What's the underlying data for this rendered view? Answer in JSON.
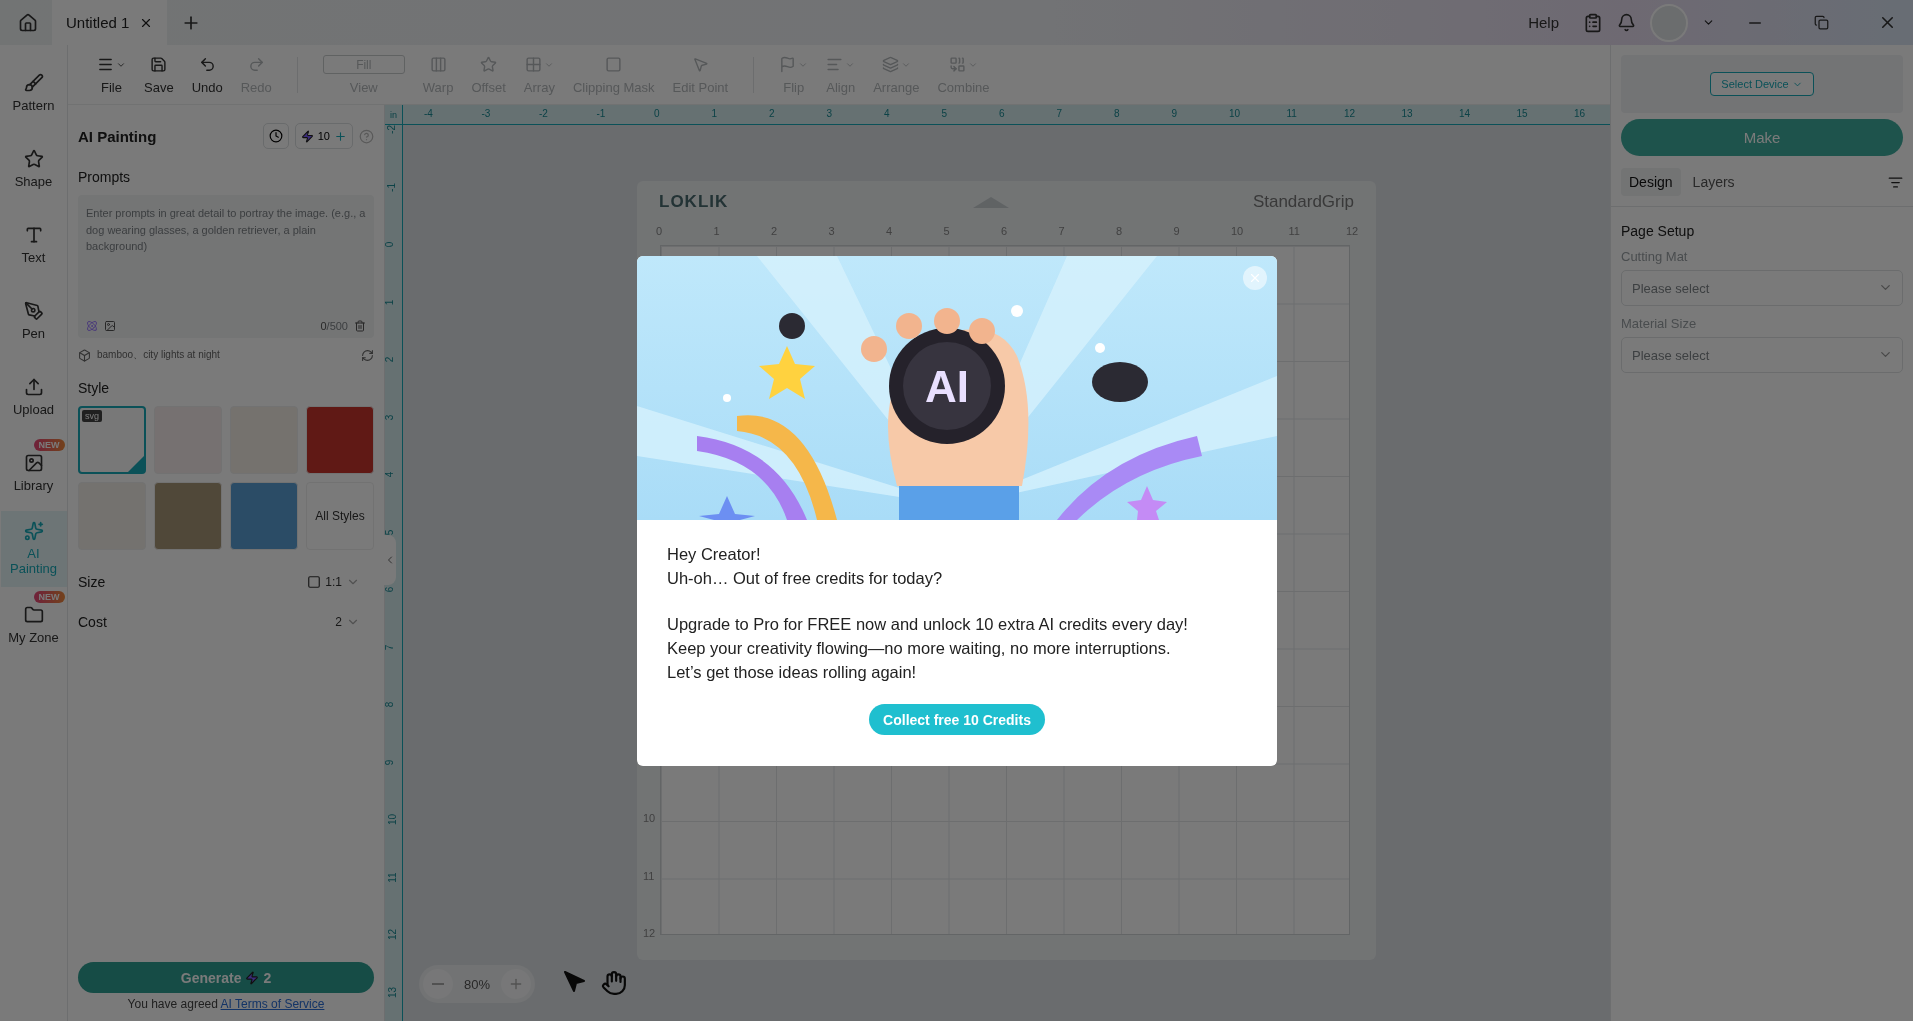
{
  "titlebar": {
    "tab": {
      "label": "Untitled 1",
      "selected": true
    },
    "help": "Help"
  },
  "rail": [
    {
      "label": "Pattern",
      "selected": false
    },
    {
      "label": "Shape",
      "selected": false
    },
    {
      "label": "Text",
      "selected": false
    },
    {
      "label": "Pen",
      "selected": false
    },
    {
      "label": "Upload",
      "selected": false
    },
    {
      "label": "Library",
      "selected": false,
      "new_badge": "NEW"
    },
    {
      "label": "AI Painting",
      "selected": true
    },
    {
      "label": "My Zone",
      "selected": false,
      "new_badge": "NEW"
    }
  ],
  "toolbar": [
    [
      {
        "label": "File",
        "disabled": false,
        "has_menu": true
      },
      {
        "label": "Save",
        "disabled": false,
        "has_menu": false
      },
      {
        "label": "Undo",
        "disabled": false,
        "has_menu": false
      },
      {
        "label": "Redo",
        "disabled": true,
        "has_menu": false
      }
    ],
    [
      {
        "label": "View",
        "disabled": true,
        "has_menu": false,
        "field": "Fill"
      },
      {
        "label": "Warp",
        "disabled": true,
        "has_menu": false
      },
      {
        "label": "Offset",
        "disabled": true,
        "has_menu": false
      },
      {
        "label": "Array",
        "disabled": true,
        "has_menu": true
      },
      {
        "label": "Clipping Mask",
        "disabled": true,
        "has_menu": false
      },
      {
        "label": "Edit Point",
        "disabled": true,
        "has_menu": false
      }
    ],
    [
      {
        "label": "Flip",
        "disabled": true,
        "has_menu": true
      },
      {
        "label": "Align",
        "disabled": true,
        "has_menu": true
      },
      {
        "label": "Arrange",
        "disabled": true,
        "has_menu": true
      },
      {
        "label": "Combine",
        "disabled": true,
        "has_menu": true
      }
    ]
  ],
  "panel": {
    "title": "AI Painting",
    "credits": "10",
    "prompts_label": "Prompts",
    "prompt": {
      "placeholder": "Enter prompts in great detail to portray the image. (e.g., a dog wearing glasses, a golden retriever, a plain background)",
      "count": "0",
      "max": "/500"
    },
    "suggestion": "bamboo、city lights at night",
    "style_label": "Style",
    "styles": [
      {
        "selected": true,
        "tag": "svg"
      },
      {
        "selected": false
      },
      {
        "selected": false
      },
      {
        "selected": false
      },
      {
        "selected": false
      },
      {
        "selected": false
      },
      {
        "selected": false
      }
    ],
    "all_styles": "All Styles",
    "size_label": "Size",
    "size_value": "1:1",
    "cost_label": "Cost",
    "cost_value": "2",
    "generate": {
      "label": "Generate",
      "cost": "2"
    },
    "terms": {
      "text": "You have agreed ",
      "link": "AI Terms of Service"
    }
  },
  "canvas": {
    "unit": "in",
    "top_ticks": [
      "-4",
      "-3",
      "-2",
      "-1",
      "0",
      "1",
      "2",
      "3",
      "4",
      "5",
      "6",
      "7",
      "8",
      "9",
      "10",
      "11",
      "12",
      "13",
      "14",
      "15",
      "16"
    ],
    "left_ticks": [
      "-2",
      "-1",
      "0",
      "1",
      "2",
      "3",
      "4",
      "5",
      "6",
      "7",
      "8",
      "9",
      "10",
      "11",
      "12",
      "13"
    ],
    "mat": {
      "brand": "LOKLIK",
      "name": "StandardGrip",
      "top_ticks": [
        "0",
        "1",
        "2",
        "3",
        "4",
        "5",
        "6",
        "7",
        "8",
        "9",
        "10",
        "11",
        "12"
      ],
      "left_ticks": [
        "10",
        "11",
        "12"
      ]
    },
    "zoom": "80%"
  },
  "right_panel": {
    "select_device": "Select Device",
    "make": "Make",
    "tabs": [
      {
        "label": "Design",
        "selected": true
      },
      {
        "label": "Layers",
        "selected": false
      }
    ],
    "section": "Page Setup",
    "fields": [
      {
        "label": "Cutting Mat",
        "placeholder": "Please select"
      },
      {
        "label": "Material Size",
        "placeholder": "Please select"
      }
    ]
  },
  "modal": {
    "badge": "AI",
    "paragraphs": [
      [
        "Hey Creator!",
        "Uh-oh… Out of free credits for today?"
      ],
      [
        "Upgrade to Pro for FREE now and unlock 10 extra AI credits every day!",
        "Keep your creativity flowing—no more waiting, no more interruptions.",
        "Let’s get those ideas rolling again!"
      ]
    ],
    "button": "Collect free 10 Credits"
  }
}
